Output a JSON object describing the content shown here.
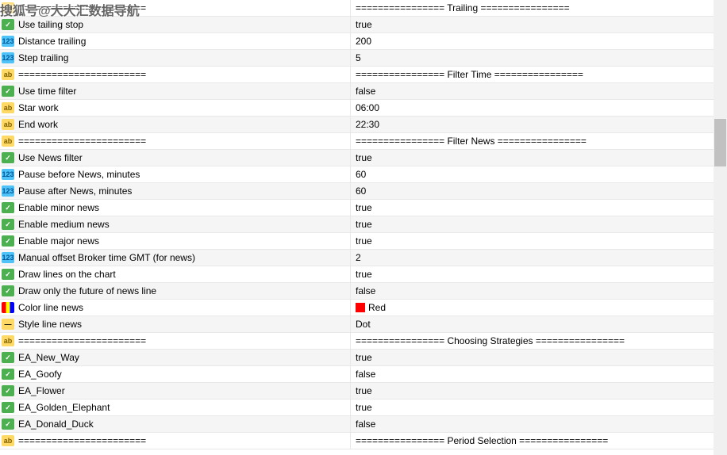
{
  "watermark": "搜狐号@大大汇数据导航",
  "icons": {
    "ab": "ab",
    "bool": "✓",
    "num": "123",
    "color": "",
    "style": "—"
  },
  "rows": [
    {
      "type": "ab",
      "name": "=======================",
      "value": "================ Trailing ================"
    },
    {
      "type": "bool",
      "name": "Use tailing stop",
      "value": "true"
    },
    {
      "type": "num",
      "name": "Distance trailing",
      "value": "200"
    },
    {
      "type": "num",
      "name": "Step trailing",
      "value": "5"
    },
    {
      "type": "ab",
      "name": "=======================",
      "value": "================ Filter Time ================"
    },
    {
      "type": "bool",
      "name": "Use time filter",
      "value": "false"
    },
    {
      "type": "ab",
      "name": "Star work",
      "value": "06:00"
    },
    {
      "type": "ab",
      "name": "End work",
      "value": "22:30"
    },
    {
      "type": "ab",
      "name": "=======================",
      "value": "================ Filter News ================"
    },
    {
      "type": "bool",
      "name": "Use News filter",
      "value": "true"
    },
    {
      "type": "num",
      "name": "Pause before News, minutes",
      "value": "60"
    },
    {
      "type": "num",
      "name": "Pause after News, minutes",
      "value": "60"
    },
    {
      "type": "bool",
      "name": "Enable minor news",
      "value": "true"
    },
    {
      "type": "bool",
      "name": "Enable medium news",
      "value": "true"
    },
    {
      "type": "bool",
      "name": "Enable major news",
      "value": "true"
    },
    {
      "type": "num",
      "name": "Manual offset Broker time GMT (for news)",
      "value": "2"
    },
    {
      "type": "bool",
      "name": "Draw lines on the chart",
      "value": "true"
    },
    {
      "type": "bool",
      "name": "Draw only the future of news line",
      "value": "false"
    },
    {
      "type": "color",
      "name": "Color line news",
      "value": "Red",
      "swatch": "#ff0000"
    },
    {
      "type": "style",
      "name": "Style  line news",
      "value": "Dot"
    },
    {
      "type": "ab",
      "name": "=======================",
      "value": "================ Choosing Strategies  ================"
    },
    {
      "type": "bool",
      "name": "EA_New_Way",
      "value": "true"
    },
    {
      "type": "bool",
      "name": "EA_Goofy",
      "value": "false"
    },
    {
      "type": "bool",
      "name": "EA_Flower",
      "value": "true"
    },
    {
      "type": "bool",
      "name": "EA_Golden_Elephant",
      "value": "true"
    },
    {
      "type": "bool",
      "name": "EA_Donald_Duck",
      "value": "false"
    },
    {
      "type": "ab",
      "name": "=======================",
      "value": "================ Period Selection  ================"
    }
  ]
}
